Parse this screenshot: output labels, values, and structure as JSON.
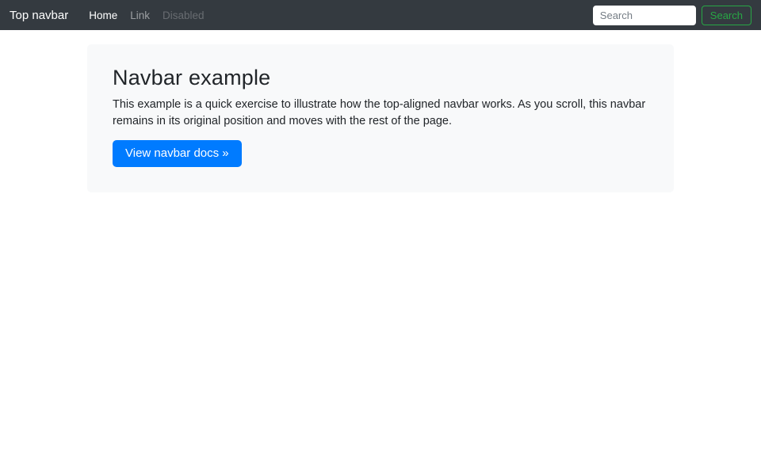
{
  "navbar": {
    "brand": "Top navbar",
    "links": [
      {
        "label": "Home",
        "state": "active"
      },
      {
        "label": "Link",
        "state": "normal"
      },
      {
        "label": "Disabled",
        "state": "disabled"
      }
    ],
    "search": {
      "placeholder": "Search",
      "button_label": "Search"
    }
  },
  "jumbotron": {
    "title": "Navbar example",
    "description": "This example is a quick exercise to illustrate how the top-aligned navbar works. As you scroll, this navbar remains in its original position and moves with the rest of the page.",
    "cta_label": "View navbar docs »"
  },
  "colors": {
    "navbar_bg": "#343a40",
    "navbar_link_active": "#ffffff",
    "navbar_link_muted": "rgba(255,255,255,0.5)",
    "navbar_link_disabled": "rgba(255,255,255,0.25)",
    "search_button_green": "#28a745",
    "primary_button_blue": "#007bff",
    "jumbotron_bg": "#f8f9fa",
    "text_dark": "#212529"
  }
}
